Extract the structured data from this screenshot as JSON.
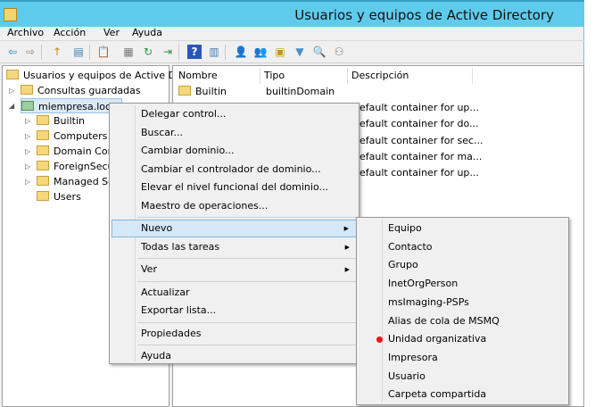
{
  "window": {
    "title": "Usuarios y equipos de Active Directory"
  },
  "menu": [
    "Archivo",
    "Acción",
    "Ver",
    "Ayuda"
  ],
  "toolbar": [
    {
      "icon": "back-arrow-icon",
      "glyph": "⇦"
    },
    {
      "icon": "forward-arrow-icon",
      "glyph": "⇨"
    },
    {
      "icon": "up-folder-icon",
      "glyph": "↑"
    },
    {
      "icon": "console-tree-icon",
      "glyph": "▤"
    },
    {
      "icon": "clipboard-icon",
      "glyph": "📋"
    },
    {
      "icon": "properties-icon",
      "glyph": "▦"
    },
    {
      "icon": "refresh-icon",
      "glyph": "↻"
    },
    {
      "icon": "export-list-icon",
      "glyph": "⇥"
    },
    {
      "icon": "help-icon",
      "glyph": "?"
    },
    {
      "icon": "action-pane-icon",
      "glyph": "▥"
    },
    {
      "icon": "new-user-icon",
      "glyph": "👤"
    },
    {
      "icon": "new-group-icon",
      "glyph": "👥"
    },
    {
      "icon": "new-ou-icon",
      "glyph": "▣"
    },
    {
      "icon": "filter-icon",
      "glyph": "▼"
    },
    {
      "icon": "find-icon",
      "glyph": "🔍"
    },
    {
      "icon": "add-to-group-icon",
      "glyph": "⚇"
    }
  ],
  "tree": {
    "root": "Usuarios y equipos de Active Dir",
    "items": [
      {
        "label": "Consultas guardadas",
        "level": 1,
        "expander": "▷"
      },
      {
        "label": "miempresa.local",
        "level": 1,
        "expander": "◢",
        "selected": true
      },
      {
        "label": "Builtin",
        "level": 2,
        "expander": "▷"
      },
      {
        "label": "Computers",
        "level": 2,
        "expander": "▷"
      },
      {
        "label": "Domain Controllers",
        "level": 2,
        "expander": "▷"
      },
      {
        "label": "ForeignSecurityPrincipals",
        "level": 2,
        "expander": "▷"
      },
      {
        "label": "Managed Service Accounts",
        "level": 2,
        "expander": "▷"
      },
      {
        "label": "Users",
        "level": 2,
        "expander": ""
      }
    ]
  },
  "list": {
    "columns": [
      "Nombre",
      "Tipo",
      "Descripción"
    ],
    "rows": [
      {
        "name": "Builtin",
        "type": "builtinDomain",
        "desc": ""
      },
      {
        "name": "",
        "type": "",
        "desc": "efault container for up..."
      },
      {
        "name": "",
        "type": "",
        "desc": "efault container for do..."
      },
      {
        "name": "",
        "type": "",
        "desc": "efault container for sec..."
      },
      {
        "name": "",
        "type": "",
        "desc": "efault container for ma..."
      },
      {
        "name": "",
        "type": "",
        "desc": "efault container for up..."
      }
    ]
  },
  "context_menu": {
    "groups": [
      [
        {
          "label": "Delegar control..."
        },
        {
          "label": "Buscar..."
        },
        {
          "label": "Cambiar dominio..."
        },
        {
          "label": "Cambiar el controlador de dominio..."
        },
        {
          "label": "Elevar el nivel funcional del dominio..."
        },
        {
          "label": "Maestro de operaciones..."
        }
      ],
      [
        {
          "label": "Nuevo",
          "submenu": true,
          "highlighted": true
        },
        {
          "label": "Todas las tareas",
          "submenu": true
        }
      ],
      [
        {
          "label": "Ver",
          "submenu": true
        }
      ],
      [
        {
          "label": "Actualizar"
        },
        {
          "label": "Exportar lista..."
        }
      ],
      [
        {
          "label": "Propiedades"
        }
      ],
      [
        {
          "label": "Ayuda"
        }
      ]
    ]
  },
  "submenu": {
    "items": [
      "Equipo",
      "Contacto",
      "Grupo",
      "InetOrgPerson",
      "msImaging-PSPs",
      "Alias de cola de MSMQ",
      "Unidad organizativa",
      "Impresora",
      "Usuario",
      "Carpeta compartida"
    ],
    "marked_item": "Unidad organizativa",
    "marker_color": "#e8141b"
  },
  "colors": {
    "titlebar": "#5fcbec",
    "highlight": "#d5e8f8"
  }
}
